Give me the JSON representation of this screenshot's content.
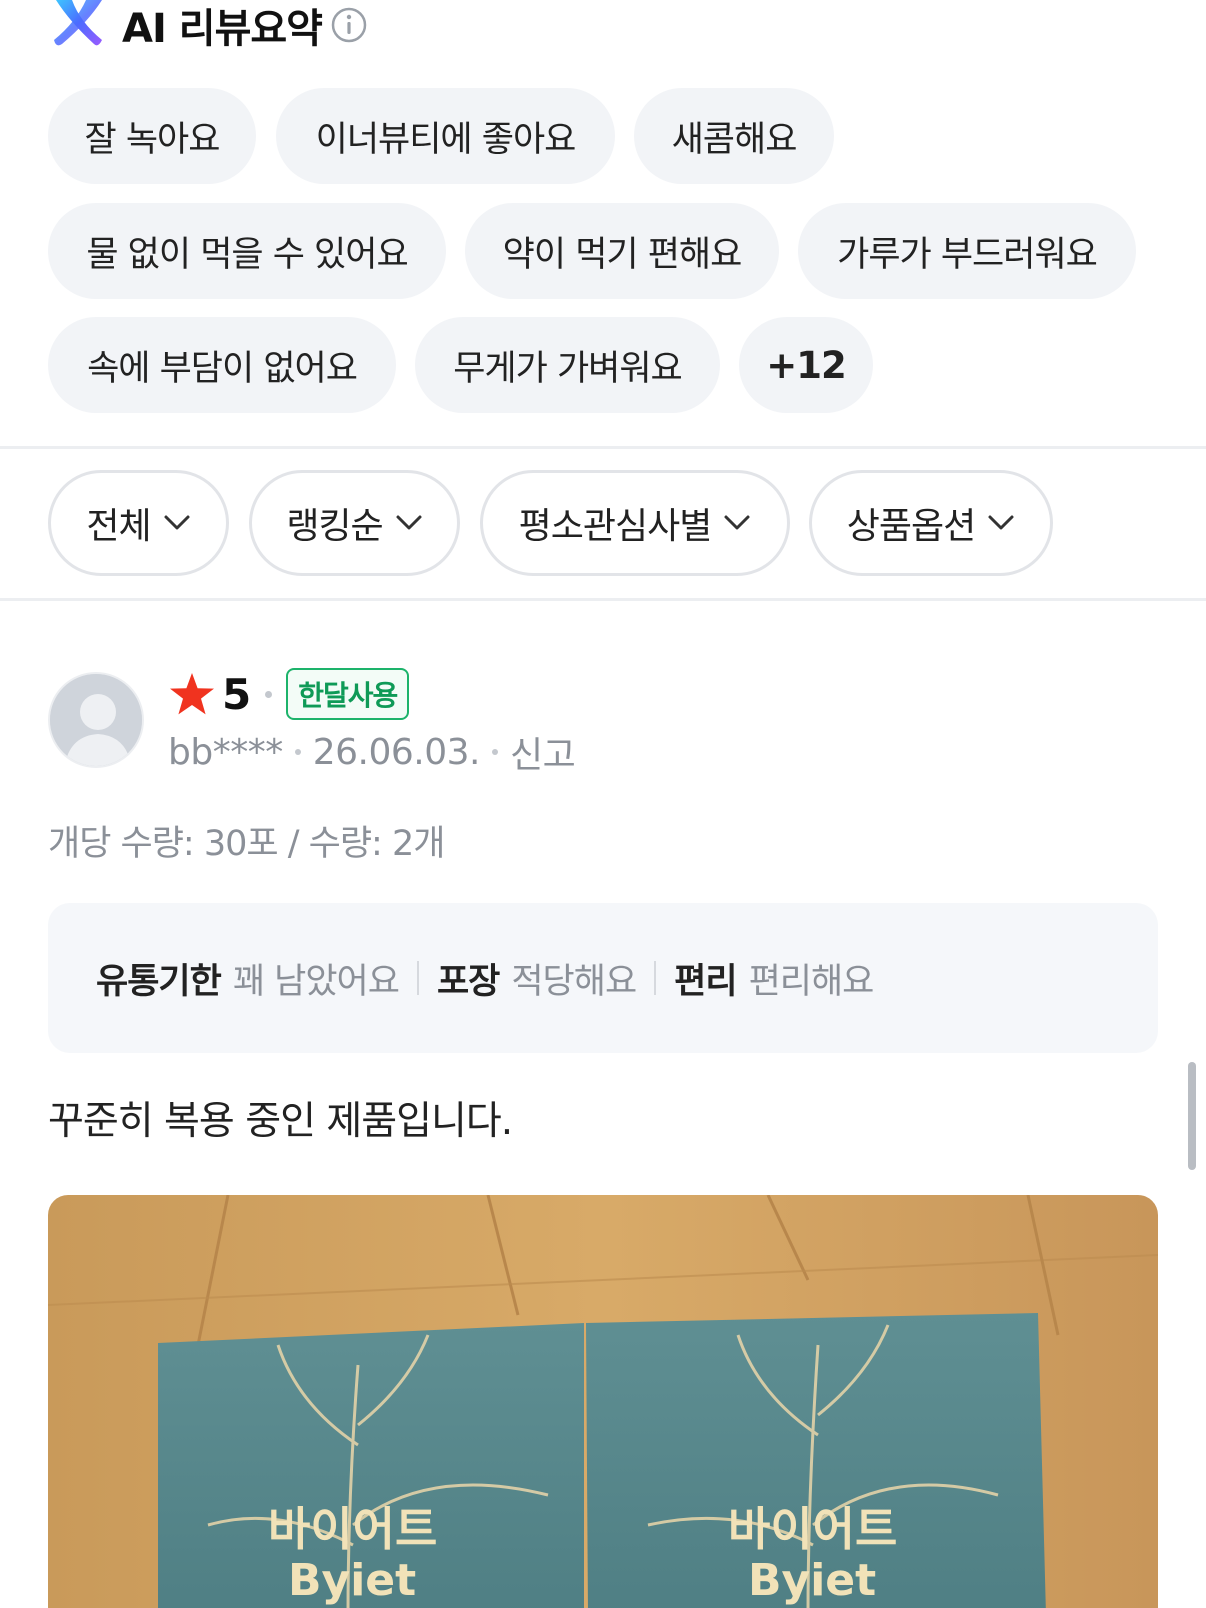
{
  "ai_summary": {
    "title": "AI 리뷰요약",
    "icons": [
      "ai-logo-icon",
      "info-icon"
    ],
    "keywords": [
      "잘 녹아요",
      "이너뷰티에 좋아요",
      "새콤해요",
      "물 없이 먹을 수 있어요",
      "약이 먹기 편해요",
      "가루가 부드러워요",
      "속에 부담이 없어요",
      "무게가 가벼워요"
    ],
    "more_label": "+12"
  },
  "filters": [
    {
      "label": "전체",
      "icon": "chevron-down-icon"
    },
    {
      "label": "랭킹순",
      "icon": "chevron-down-icon"
    },
    {
      "label": "평소관심사별",
      "icon": "chevron-down-icon"
    },
    {
      "label": "상품옵션",
      "icon": "chevron-down-icon"
    }
  ],
  "review": {
    "rating": "5",
    "badge": "한달사용",
    "user": "bb****",
    "date": "26.06.03.",
    "report": "신고",
    "option": "개당 수량: 30포 / 수량: 2개",
    "evaluations": [
      {
        "key": "유통기한",
        "value": "꽤 남았어요"
      },
      {
        "key": "포장",
        "value": "적당해요"
      },
      {
        "key": "편리",
        "value": "편리해요"
      }
    ],
    "text": "꾸준히 복용 중인 제품입니다.",
    "photo": {
      "box_left": {
        "name_ko": "바이어트",
        "name_en": "Byiet"
      },
      "box_right": {
        "name_ko": "바이어트",
        "name_en": "Byiet"
      }
    }
  },
  "colors": {
    "chip_bg": "#f2f4f7",
    "star": "#f0331f",
    "badge_green": "#1db36b",
    "box_teal": "#5a8a8e"
  }
}
